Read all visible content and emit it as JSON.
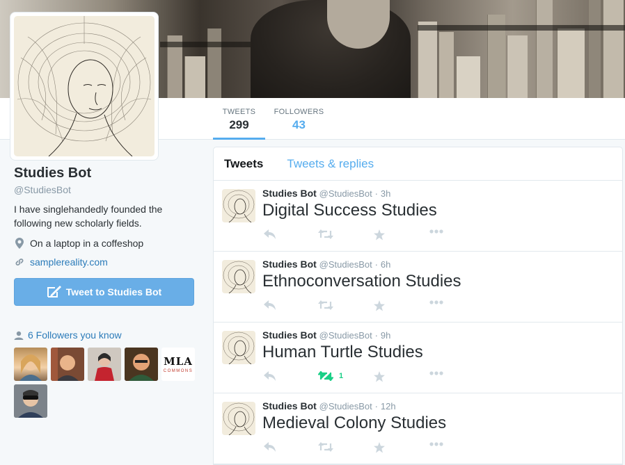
{
  "profile": {
    "name": "Studies Bot",
    "handle": "@StudiesBot",
    "bio": "I have singlehandedly founded the following new scholarly fields.",
    "location": "On a laptop in a coffeshop",
    "website": "samplereality.com",
    "tweet_to_label": "Tweet to Studies Bot",
    "followers_you_know": "6 Followers you know",
    "followers_you_know_logo": {
      "title": "MLA",
      "subtitle": "COMMONS"
    },
    "location_icon": "location-pin-icon",
    "website_icon": "link-icon",
    "tweet_to_icon": "compose-icon",
    "followers_icon": "person-icon"
  },
  "nav": {
    "tweets_label": "TWEETS",
    "tweets_count": "299",
    "followers_label": "FOLLOWERS",
    "followers_count": "43"
  },
  "timeline": {
    "tabs": [
      "Tweets",
      "Tweets & replies"
    ],
    "tweets": [
      {
        "name": "Studies Bot",
        "handle": "@StudiesBot",
        "time": "3h",
        "text": "Digital Success Studies",
        "retweets": ""
      },
      {
        "name": "Studies Bot",
        "handle": "@StudiesBot",
        "time": "6h",
        "text": "Ethnoconversation Studies",
        "retweets": ""
      },
      {
        "name": "Studies Bot",
        "handle": "@StudiesBot",
        "time": "9h",
        "text": "Human Turtle Studies",
        "retweets": "1"
      },
      {
        "name": "Studies Bot",
        "handle": "@StudiesBot",
        "time": "12h",
        "text": "Medieval Colony Studies",
        "retweets": ""
      }
    ]
  },
  "colors": {
    "accent": "#55acee",
    "link": "#2b7bb9",
    "retweet_active": "#19cf86",
    "muted": "#8899a6"
  }
}
